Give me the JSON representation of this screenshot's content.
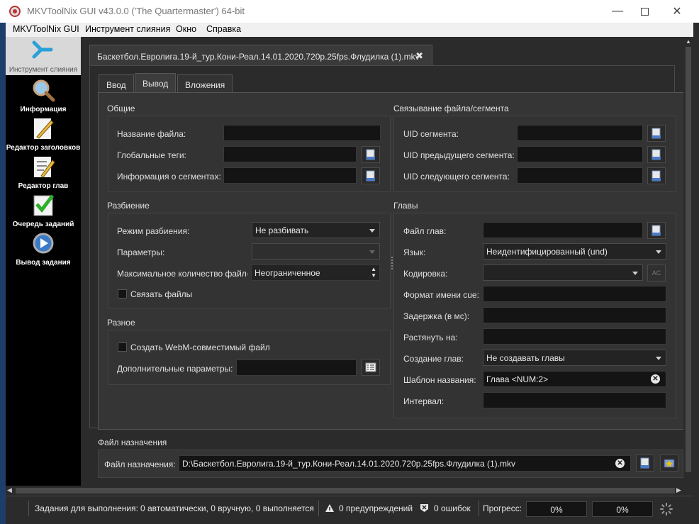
{
  "window": {
    "title": "MKVToolNix GUI v43.0.0 ('The Quartermaster') 64-bit"
  },
  "menu": [
    "MKVToolNix GUI",
    "Инструмент слияния",
    "Окно",
    "Справка"
  ],
  "sidebar": [
    {
      "label": "Инструмент слияния",
      "icon": "merge-icon"
    },
    {
      "label": "Информация",
      "icon": "magnifier-icon"
    },
    {
      "label": "Редактор заголовков",
      "icon": "pencil-icon"
    },
    {
      "label": "Редактор глав",
      "icon": "chapter-edit-icon"
    },
    {
      "label": "Очередь заданий",
      "icon": "checklist-icon"
    },
    {
      "label": "Вывод задания",
      "icon": "play-icon"
    }
  ],
  "file_tab": {
    "label": "Баскетбол.Евролига.19-й_тур.Кони-Реал.14.01.2020.720p.25fps.Флудилка (1).mkv"
  },
  "tabs": [
    "Ввод",
    "Вывод",
    "Вложения"
  ],
  "general": {
    "title": "Общие",
    "file_title_label": "Название файла:",
    "global_tags_label": "Глобальные теги:",
    "segment_info_label": "Информация о сегментах:"
  },
  "linking": {
    "title": "Связывание файла/сегмента",
    "segment_uid_label": "UID сегмента:",
    "prev_uid_label": "UID предыдущего сегмента:",
    "next_uid_label": "UID следующего сегмента:"
  },
  "splitting": {
    "title": "Разбиение",
    "mode_label": "Режим разбиения:",
    "mode_value": "Не разбивать",
    "params_label": "Параметры:",
    "max_files_label": "Максимальное количество файлов",
    "max_files_value": "Неограниченное",
    "link_files_label": "Связать файлы"
  },
  "misc": {
    "title": "Разное",
    "webm_label": "Создать WebM-совместимый файл",
    "extra_params_label": "Дополнительные параметры:"
  },
  "chapters": {
    "title": "Главы",
    "file_label": "Файл глав:",
    "language_label": "Язык:",
    "language_value": "Неидентифицированный (und)",
    "charset_label": "Кодировка:",
    "charset_btn": "AC",
    "cue_format_label": "Формат имени cue:",
    "delay_label": "Задержка (в мс):",
    "stretch_label": "Растянуть на:",
    "generation_label": "Создание глав:",
    "generation_value": "Не создавать главы",
    "name_template_label": "Шаблон названия:",
    "name_template_value": "Глава <NUM:2>",
    "interval_label": "Интервал:"
  },
  "destination": {
    "title": "Файл назначения",
    "label": "Файл назначения:",
    "value": "D:\\Баскетбол.Евролига.19-й_тур.Кони-Реал.14.01.2020.720p.25fps.Флудилка (1).mkv"
  },
  "status": {
    "jobs_label": "Задания для выполнения:",
    "jobs_value": "0 автоматически, 0 вручную, 0 выполняется",
    "warnings": "0 предупреждений",
    "errors": "0 ошибок",
    "progress_label": "Прогресс:",
    "progress1": "0%",
    "progress2": "0%"
  }
}
